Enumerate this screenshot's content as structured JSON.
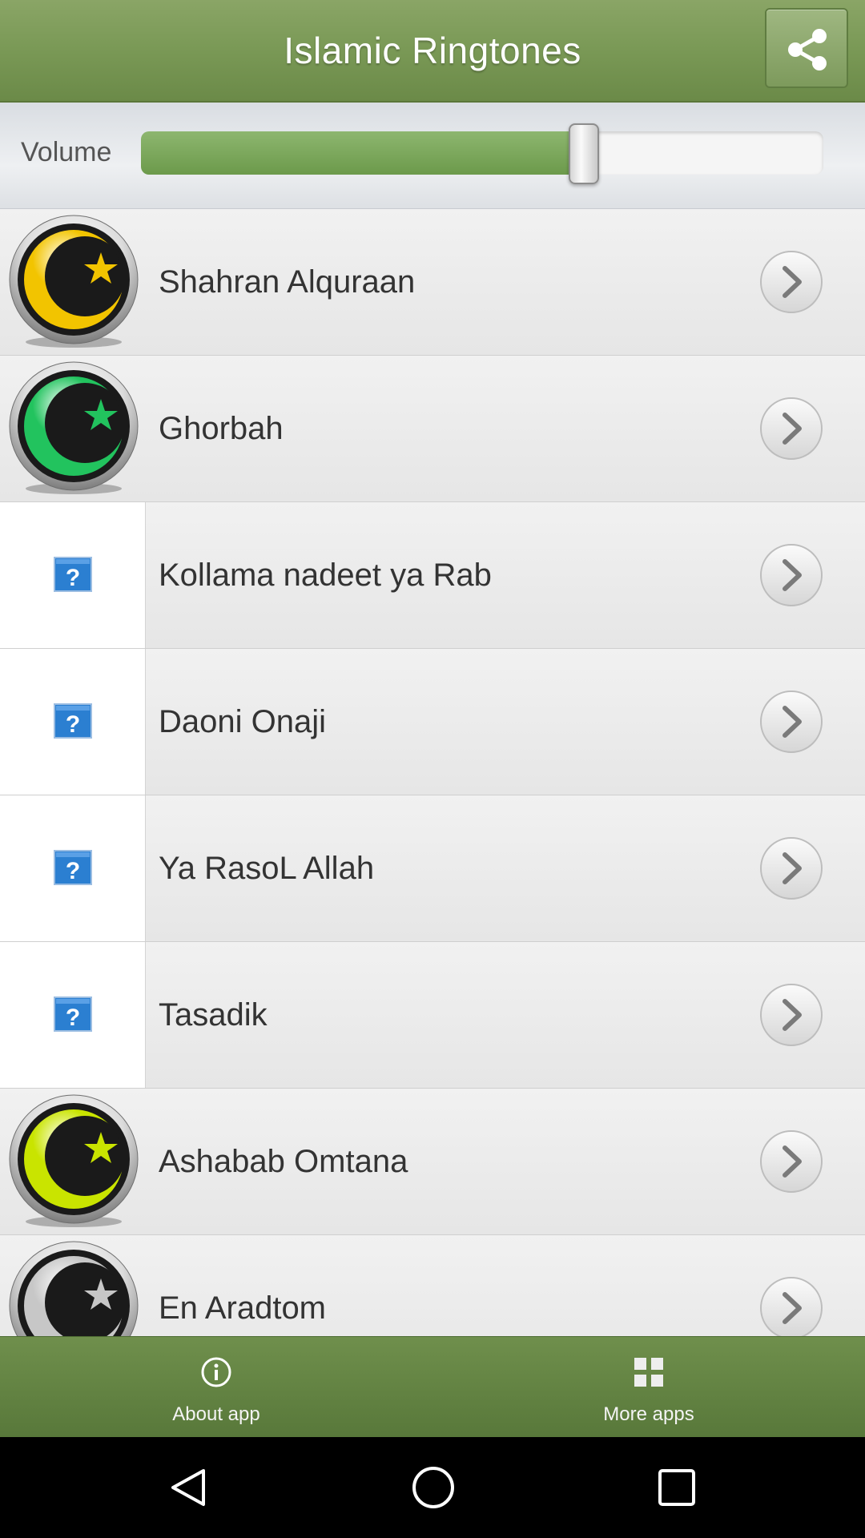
{
  "header": {
    "title": "Islamic Ringtones",
    "share_icon": "share-icon"
  },
  "volume": {
    "label": "Volume",
    "level_fraction": 0.66
  },
  "ringtones": [
    {
      "name": "Shahran Alquraan",
      "icon": "crescent-star-icon",
      "icon_color": "#f2c400"
    },
    {
      "name": "Ghorbah",
      "icon": "crescent-star-icon",
      "icon_color": "#22c35e"
    },
    {
      "name": "Kollama nadeet ya Rab",
      "icon": "unknown-file-icon",
      "icon_color": null
    },
    {
      "name": "Daoni Onaji",
      "icon": "unknown-file-icon",
      "icon_color": null
    },
    {
      "name": "Ya RasoL Allah",
      "icon": "unknown-file-icon",
      "icon_color": null
    },
    {
      "name": "Tasadik",
      "icon": "unknown-file-icon",
      "icon_color": null
    },
    {
      "name": "Ashabab Omtana",
      "icon": "crescent-star-icon",
      "icon_color": "#c9e400"
    },
    {
      "name": "En Aradtom",
      "icon": "crescent-star-icon",
      "icon_color": "#c7c7c7"
    }
  ],
  "bottom_bar": {
    "about_label": "About app",
    "about_icon": "info-icon",
    "more_label": "More apps",
    "more_icon": "grid-icon"
  },
  "colors": {
    "header_green": "#7b9a57",
    "bottom_green": "#5f7f40",
    "slider_fill": "#7ba85a"
  }
}
